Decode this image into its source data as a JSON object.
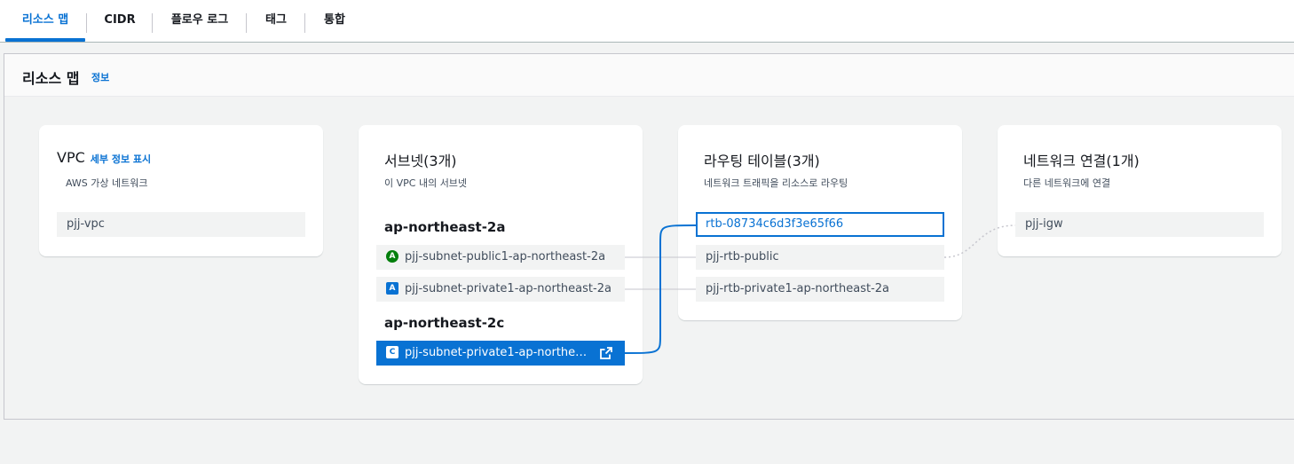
{
  "tabs": [
    {
      "label": "리소스 맵",
      "active": true
    },
    {
      "label": "CIDR"
    },
    {
      "label": "플로우 로그"
    },
    {
      "label": "태그"
    },
    {
      "label": "통합"
    }
  ],
  "panel": {
    "title": "리소스 맵",
    "info_link": "정보"
  },
  "vpc": {
    "title": "VPC",
    "detail_link": "세부 정보 표시",
    "subtitle": "AWS 가상 네트워크",
    "item": "pjj-vpc"
  },
  "subnets": {
    "title": "서브넷(3개)",
    "subtitle": "이 VPC 내의 서브넷",
    "zones": [
      {
        "name": "ap-northeast-2a",
        "items": [
          {
            "badge": "A",
            "label": "pjj-subnet-public1-ap-northeast-2a"
          },
          {
            "badge": "A",
            "label": "pjj-subnet-private1-ap-northeast-2a"
          }
        ]
      },
      {
        "name": "ap-northeast-2c",
        "items": [
          {
            "badge": "C",
            "label": "pjj-subnet-private1-ap-northe…",
            "selected": true
          }
        ]
      }
    ]
  },
  "route_tables": {
    "title": "라우팅 테이블(3개)",
    "subtitle": "네트워크 트래픽을 리소스로 라우팅",
    "items": [
      {
        "label": "rtb-08734c6d3f3e65f66",
        "highlighted": true
      },
      {
        "label": "pjj-rtb-public"
      },
      {
        "label": "pjj-rtb-private1-ap-northeast-2a"
      }
    ]
  },
  "network": {
    "title": "네트워크 연결(1개)",
    "subtitle": "다른 네트워크에 연결",
    "item": "pjj-igw"
  },
  "colors": {
    "accent": "#0972d3",
    "public_badge": "#037f0c",
    "connector": "#c6c6cd"
  },
  "icons": {
    "external_link": "external-link-icon"
  }
}
